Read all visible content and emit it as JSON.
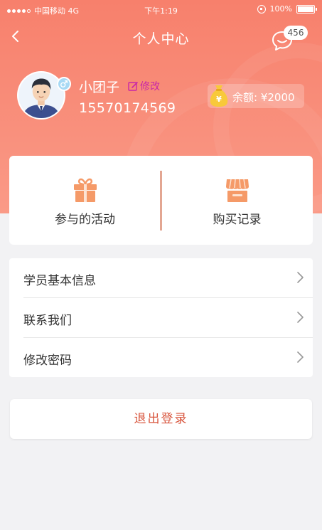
{
  "status_bar": {
    "carrier": "中国移动 4G",
    "time": "下午1:19",
    "battery": "100%"
  },
  "nav": {
    "title": "个人中心",
    "message_count": "456"
  },
  "profile": {
    "username": "小团子",
    "edit_label": "修改",
    "phone": "15570174569",
    "balance": "余额: ¥2000"
  },
  "actions": [
    {
      "label": "参与的活动",
      "icon": "gift-icon"
    },
    {
      "label": "购买记录",
      "icon": "shop-icon"
    }
  ],
  "menu": [
    {
      "label": "学员基本信息"
    },
    {
      "label": "联系我们"
    },
    {
      "label": "修改密码"
    }
  ],
  "logout_label": "退出登录",
  "colors": {
    "header_start": "#f7806c",
    "header_end": "#fa9a87",
    "accent_orange": "#f59a68",
    "logout_text": "#d8553d",
    "edit_text": "#c826a8",
    "background": "#f2f2f4"
  }
}
